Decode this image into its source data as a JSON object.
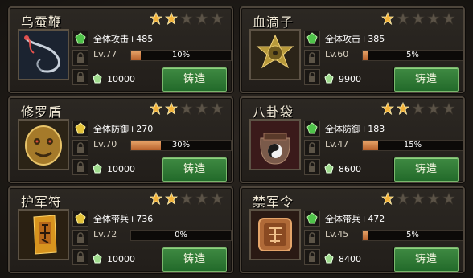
{
  "cards": [
    {
      "name": "乌蚕鞭",
      "stars": 2,
      "attr": "全体攻击+485",
      "level": "Lv.77",
      "progress": 0.1,
      "pct": "10%",
      "cost": "10000",
      "btn": "铸造",
      "icon": "whip-icon",
      "gem": "green"
    },
    {
      "name": "血滴子",
      "stars": 1,
      "attr": "全体攻击+385",
      "level": "Lv.60",
      "progress": 0.05,
      "pct": "5%",
      "cost": "9900",
      "btn": "铸造",
      "icon": "blood-drop-weapon-icon",
      "gem": "green"
    },
    {
      "name": "修罗盾",
      "stars": 2,
      "attr": "全体防御+270",
      "level": "Lv.70",
      "progress": 0.3,
      "pct": "30%",
      "cost": "10000",
      "btn": "铸造",
      "icon": "shield-icon",
      "gem": "yellow"
    },
    {
      "name": "八卦袋",
      "stars": 2,
      "attr": "全体防御+183",
      "level": "Lv.47",
      "progress": 0.15,
      "pct": "15%",
      "cost": "8600",
      "btn": "铸造",
      "icon": "bagua-bag-icon",
      "gem": "green"
    },
    {
      "name": "护军符",
      "stars": 2,
      "attr": "全体带兵+736",
      "level": "Lv.72",
      "progress": 0.0,
      "pct": "0%",
      "cost": "10000",
      "btn": "铸造",
      "icon": "talisman-icon",
      "gem": "yellow"
    },
    {
      "name": "禁军令",
      "stars": 1,
      "attr": "全体带兵+472",
      "level": "Lv.45",
      "progress": 0.05,
      "pct": "5%",
      "cost": "8400",
      "btn": "铸造",
      "icon": "command-token-icon",
      "gem": "green"
    }
  ],
  "max_stars": 5,
  "colors": {
    "star_on": "#f2b23a",
    "star_off": "#5b5347",
    "forge_button": "#2f7d35",
    "bar_fill": "#d98b4e"
  }
}
